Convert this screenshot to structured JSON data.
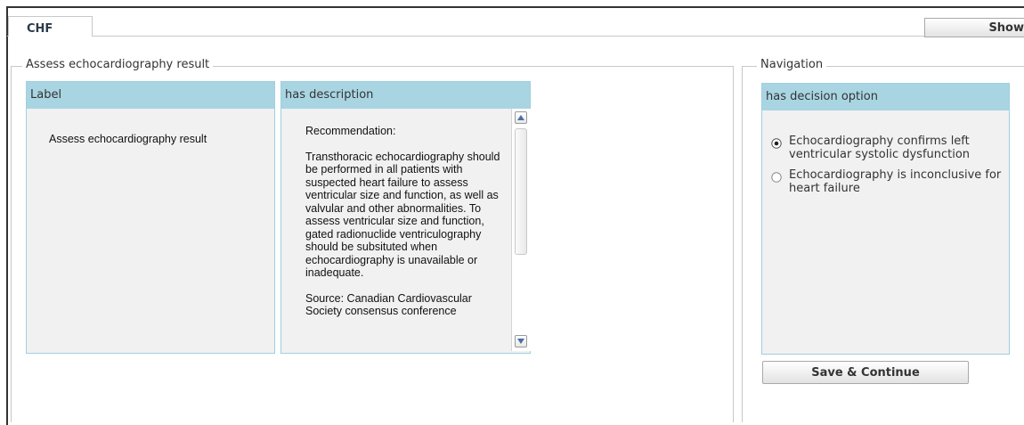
{
  "tabs": {
    "active_label": "CHF"
  },
  "header": {
    "show_button_label": "Show"
  },
  "assess_section": {
    "legend": "Assess echocardiography result",
    "label_column": {
      "header": "Label",
      "value": "Assess echocardiography result"
    },
    "description_column": {
      "header": "has description",
      "paragraphs": [
        "Recommendation:",
        "Transthoracic echocardiography should be performed in all patients with suspected heart failure to assess ventricular size and function, as well as valvular and other abnormalities. To assess ventricular size and function, gated radionuclide ventriculography should be subsituted when echocardiography is unavailable or inadequate.",
        "Source: Canadian Cardiovascular Society consensus conference"
      ]
    }
  },
  "navigation": {
    "legend": "Navigation",
    "options_header": "has decision option",
    "options": [
      {
        "label": "Echocardiography confirms left ventricular systolic dysfunction",
        "selected": true
      },
      {
        "label": "Echocardiography is inconclusive for heart failure",
        "selected": false
      }
    ],
    "save_button_label": "Save & Continue"
  }
}
